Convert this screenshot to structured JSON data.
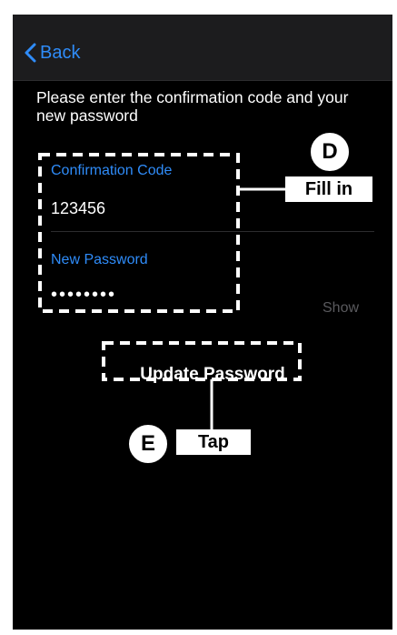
{
  "nav": {
    "back_label": "Back"
  },
  "form": {
    "instructions": "Please enter the confirmation code and your new password",
    "code_label": "Confirmation Code",
    "code_value": "123456",
    "password_label": "New Password",
    "password_value": "••••••••",
    "show_label": "Show",
    "update_label": "Update Password"
  },
  "annotations": {
    "step_d": "D",
    "step_d_action": "Fill in",
    "step_e": "E",
    "step_e_action": "Tap"
  },
  "colors": {
    "accent": "#2f8cf9",
    "background": "#000000",
    "nav_background": "#1c1c1e",
    "muted": "#5a5a5e"
  }
}
